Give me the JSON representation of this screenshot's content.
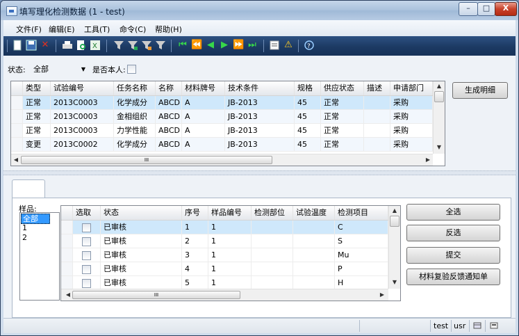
{
  "window": {
    "title": "填写理化检测数据 (1 - test)",
    "controls": {
      "minimize": "–",
      "maximize": "□",
      "close": "X"
    }
  },
  "menu": [
    "文件(F)",
    "编辑(E)",
    "工具(T)",
    "命令(C)",
    "帮助(H)"
  ],
  "toolbar_icons": [
    "new-document-icon",
    "save-icon",
    "delete-icon",
    "print-icon",
    "print-preview-icon",
    "export-excel-icon",
    "filter-icon",
    "filter-edit-icon",
    "filter-advanced-icon",
    "filter-clear-icon",
    "first-record-icon",
    "previous-page-icon",
    "previous-record-icon",
    "next-record-icon",
    "next-page-icon",
    "last-record-icon",
    "notes-icon",
    "alert-icon",
    "help-icon"
  ],
  "filter": {
    "status_label": "状态:",
    "status_value": "全部",
    "self_label": "是否本人:"
  },
  "top_grid": {
    "columns": [
      "类型",
      "试验编号",
      "任务名称",
      "名称",
      "材料牌号",
      "技术条件",
      "规格",
      "供应状态",
      "描述",
      "申请部门"
    ],
    "rows": [
      [
        "正常",
        "2013C0003",
        "化学成分",
        "ABCD",
        "A",
        "JB-2013",
        "45",
        "正常",
        "",
        "采购"
      ],
      [
        "正常",
        "2013C0003",
        "金相组织",
        "ABCD",
        "A",
        "JB-2013",
        "45",
        "正常",
        "",
        "采购"
      ],
      [
        "正常",
        "2013C0003",
        "力学性能",
        "ABCD",
        "A",
        "JB-2013",
        "45",
        "正常",
        "",
        "采购"
      ],
      [
        "变更",
        "2013C0002",
        "化学成分",
        "ABCD",
        "A",
        "JB-2013",
        "45",
        "正常",
        "",
        "采购"
      ]
    ],
    "selected_row": 0,
    "scroll_glyph": "III"
  },
  "buttons": {
    "generate_detail": "生成明细",
    "select_all": "全选",
    "invert_select": "反选",
    "submit": "提交",
    "feedback_notice": "材料复验反馈通知单"
  },
  "sample_list": {
    "label": "样品:",
    "items": [
      "全部",
      "1",
      "2"
    ],
    "selected": 0
  },
  "bottom_grid": {
    "columns": [
      "选取",
      "状态",
      "序号",
      "样品编号",
      "检测部位",
      "试验温度",
      "检测项目"
    ],
    "rows": [
      [
        "",
        "已审核",
        "1",
        "1",
        "",
        "",
        "C"
      ],
      [
        "",
        "已审核",
        "2",
        "1",
        "",
        "",
        "S"
      ],
      [
        "",
        "已审核",
        "3",
        "1",
        "",
        "",
        "Mu"
      ],
      [
        "",
        "已审核",
        "4",
        "1",
        "",
        "",
        "P"
      ],
      [
        "",
        "已审核",
        "5",
        "1",
        "",
        "",
        "H"
      ]
    ],
    "selected_row": 0,
    "scroll_glyph": "III"
  },
  "statusbar": {
    "user": "test",
    "role": "usr"
  },
  "colors": {
    "selected_row": "#cfe8fb",
    "toolbar": "#1c3a63",
    "alt_row": "#f2f7fd"
  }
}
